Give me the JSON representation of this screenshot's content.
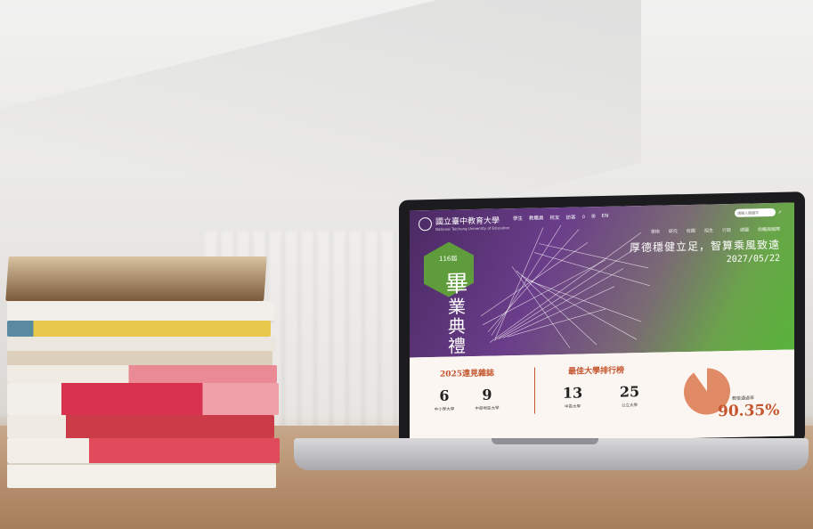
{
  "site": {
    "logo_text": "國立臺中教育大學",
    "logo_sub": "National Taichung University of Education",
    "top_links": [
      "學生",
      "教職員",
      "校友",
      "訪客",
      "EN"
    ],
    "search_placeholder": "請輸入關鍵字",
    "sub_nav": [
      "學術",
      "研究",
      "校園",
      "招生",
      "行政",
      "總圖",
      "前瞻與國際"
    ]
  },
  "hero": {
    "badge": "116屆",
    "title_chars": [
      "畢",
      "業",
      "典",
      "禮"
    ],
    "slogan": "厚德穩健立足，智算乘風致遠",
    "date": "2027/05/22"
  },
  "stats": {
    "magazine_title": "2025遠見雜誌",
    "magazine_items": [
      {
        "value": "6",
        "caption": "中小學大學"
      },
      {
        "value": "9",
        "caption": "中部地區大學"
      }
    ],
    "ranking_title": "最佳大學排行榜",
    "ranking_items": [
      {
        "value": "13",
        "caption": "中區大學"
      },
      {
        "value": "25",
        "caption": "公立大學"
      }
    ],
    "rate_label": "教檢通過率",
    "rate_value": "90.35%",
    "rate_fraction": 0.9035
  },
  "colors": {
    "accent": "#c4552e",
    "hero_purple": "#5a3278",
    "hero_green": "#58b33a"
  }
}
